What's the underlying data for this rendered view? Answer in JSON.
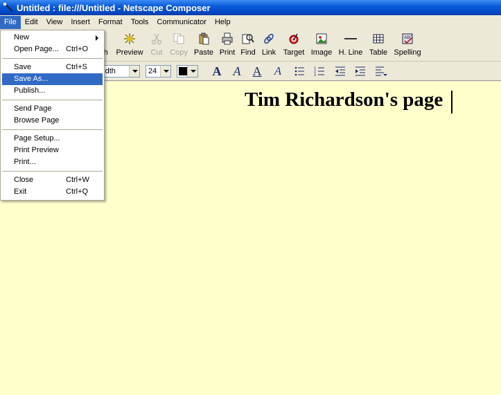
{
  "window": {
    "title": "Untitled : file:///Untitled - Netscape Composer"
  },
  "menubar": [
    "File",
    "Edit",
    "View",
    "Insert",
    "Format",
    "Tools",
    "Communicator",
    "Help"
  ],
  "toolbar": {
    "publish_partial": "sh",
    "preview": "Preview",
    "cut": "Cut",
    "copy": "Copy",
    "paste": "Paste",
    "print": "Print",
    "find": "Find",
    "link": "Link",
    "target": "Target",
    "image": "Image",
    "hline": "H. Line",
    "table": "Table",
    "spelling": "Spelling"
  },
  "format_toolbar": {
    "font_partial": "Vidth",
    "font_size": "24",
    "text_color": "#000000"
  },
  "file_menu": [
    {
      "label": "New",
      "shortcut": "",
      "submenu": true
    },
    {
      "label": "Open Page...",
      "shortcut": "Ctrl+O"
    },
    {
      "sep": true
    },
    {
      "label": "Save",
      "shortcut": "Ctrl+S"
    },
    {
      "label": "Save As...",
      "shortcut": "",
      "highlighted": true
    },
    {
      "label": "Publish...",
      "shortcut": ""
    },
    {
      "sep": true
    },
    {
      "label": "Send Page",
      "shortcut": ""
    },
    {
      "label": "Browse Page",
      "shortcut": ""
    },
    {
      "sep": true
    },
    {
      "label": "Page Setup...",
      "shortcut": ""
    },
    {
      "label": "Print Preview",
      "shortcut": ""
    },
    {
      "label": "Print...",
      "shortcut": ""
    },
    {
      "sep": true
    },
    {
      "label": "Close",
      "shortcut": "Ctrl+W"
    },
    {
      "label": "Exit",
      "shortcut": "Ctrl+Q"
    }
  ],
  "document": {
    "heading": "Tim Richardson's page"
  },
  "colors": {
    "editor_bg": "#ffffcc",
    "highlight": "#316ac5",
    "titlebar": "#0a5bd9"
  }
}
